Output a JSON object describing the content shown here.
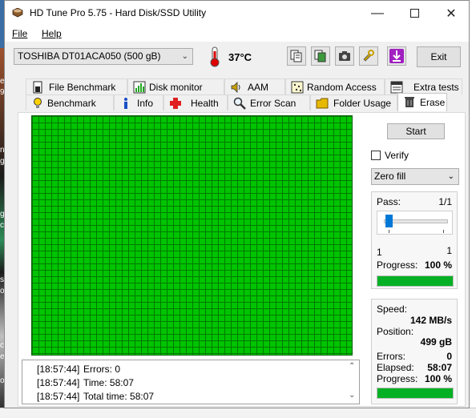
{
  "window": {
    "title": "HD Tune Pro 5.75 - Hard Disk/SSD Utility"
  },
  "menu": {
    "file": "File",
    "help": "Help"
  },
  "toolbar": {
    "drive": "TOSHIBA DT01ACA050 (500 gB)",
    "temperature": "37°C",
    "exit_label": "Exit",
    "icons": [
      "copy-info-icon",
      "copy-screenshot-icon",
      "camera-icon",
      "options-icon",
      "save-icon"
    ]
  },
  "tabs_row1": [
    "File Benchmark",
    "Disk monitor",
    "AAM",
    "Random Access",
    "Extra tests"
  ],
  "tabs_row2": [
    "Benchmark",
    "Info",
    "Health",
    "Error Scan",
    "Folder Usage",
    "Erase"
  ],
  "active_tab": "Erase",
  "erase": {
    "start_label": "Start",
    "verify_label": "Verify",
    "verify_checked": false,
    "fill_mode": "Zero fill",
    "pass_label": "Pass:",
    "pass_value": "1/1",
    "slider_min": "1",
    "slider_max": "1",
    "progress_label": "Progress:",
    "progress_value": "100 %",
    "pass_progress_fraction": 1.0,
    "speed_label": "Speed:",
    "speed_value": "142 MB/s",
    "position_label": "Position:",
    "position_value": "499 gB",
    "errors_label": "Errors:",
    "errors_value": "0",
    "elapsed_label": "Elapsed:",
    "elapsed_value": "58:07",
    "total_progress_label": "Progress:",
    "total_progress_value": "100 %",
    "total_progress_fraction": 1.0
  },
  "log": [
    {
      "time": "[18:57:44]",
      "text": "Errors: 0"
    },
    {
      "time": "[18:57:44]",
      "text": "Time: 58:07"
    },
    {
      "time": "[18:57:44]",
      "text": "Total time: 58:07"
    }
  ],
  "colors": {
    "block_ok": "#00c400",
    "progress_fill": "#06b025",
    "slider_thumb": "#0078d7"
  }
}
